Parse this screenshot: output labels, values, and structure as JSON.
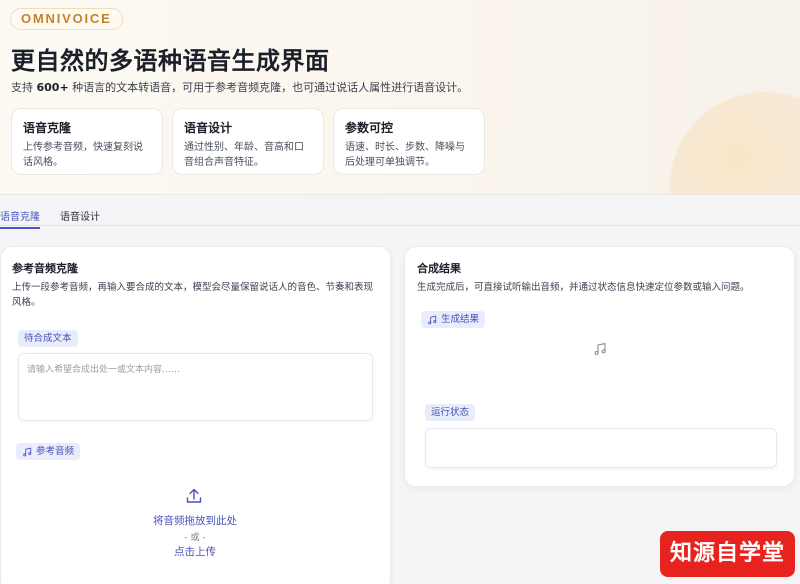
{
  "header": {
    "brand": "OMNIVOICE",
    "title": "更自然的多语种语音生成界面",
    "subtitle_prefix": "支持 ",
    "subtitle_strong": "600+",
    "subtitle_suffix": " 种语言的文本转语音，可用于参考音频克隆，也可通过说话人属性进行语音设计。"
  },
  "features": [
    {
      "title": "语音克隆",
      "desc": "上传参考音频，快速复刻说话风格。"
    },
    {
      "title": "语音设计",
      "desc": "通过性别、年龄、音高和口音组合声音特征。"
    },
    {
      "title": "参数可控",
      "desc": "语速、时长、步数、降噪与后处理可单独调节。"
    }
  ],
  "tabs": [
    {
      "label": "语音克隆",
      "active": true
    },
    {
      "label": "语音设计",
      "active": false
    }
  ],
  "clone_panel": {
    "title": "参考音频克隆",
    "desc": "上传一段参考音频，再输入要合成的文本，模型会尽量保留说话人的音色、节奏和表现风格。",
    "text_label": "待合成文本",
    "text_placeholder": "请输入希望合成出处一或文本内容……",
    "audio_label": "参考音频",
    "upload_drop": "将音频拖放到此处",
    "upload_or": "- 或 -",
    "upload_click": "点击上传"
  },
  "result_panel": {
    "title": "合成结果",
    "desc": "生成完成后，可直接试听输出音频，并通过状态信息快速定位参数或输入问题。",
    "output_label": "生成结果",
    "status_label": "运行状态",
    "status_value": ""
  },
  "watermark": "知源自学堂",
  "icons": {
    "music": "music-note-icon",
    "upload": "upload-icon"
  },
  "colors": {
    "accent": "#4b55c8",
    "brand": "#c5822a",
    "chip_bg": "#e9ecfb",
    "watermark_bg": "#e8231f"
  }
}
